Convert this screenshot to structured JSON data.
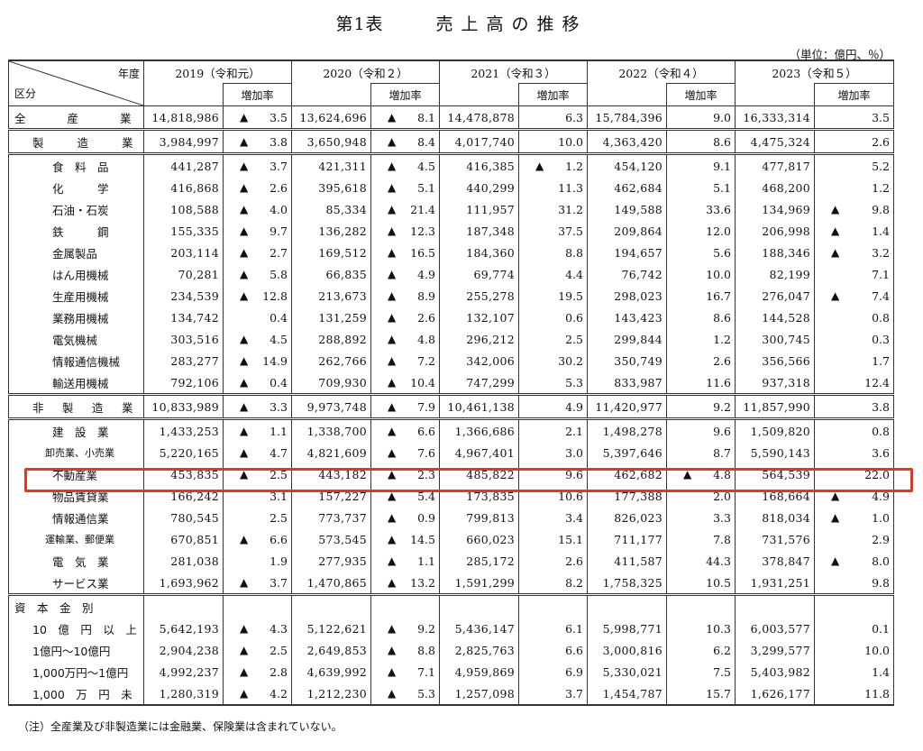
{
  "title": {
    "part1": "第1表",
    "part2": "売上高の推移"
  },
  "unit": "（単位：億円、％）",
  "header": {
    "nendo": "年度",
    "kubun": "区分",
    "years": [
      "2019（令和元）",
      "2020（令和２）",
      "2021（令和３）",
      "2022（令和４）",
      "2023（令和５）"
    ],
    "rate_label": "増加率"
  },
  "rows": [
    {
      "label": "全　　産　　業",
      "style": "grp",
      "vals": [
        [
          "14,818,986",
          "▲",
          "3.5"
        ],
        [
          "13,624,696",
          "▲",
          "8.1"
        ],
        [
          "14,478,878",
          "",
          "6.3"
        ],
        [
          "15,784,396",
          "",
          "9.0"
        ],
        [
          "16,333,314",
          "",
          "3.5"
        ]
      ]
    },
    {
      "label": "製　　造　　業",
      "style": "grp2",
      "vals": [
        [
          "3,984,997",
          "▲",
          "3.8"
        ],
        [
          "3,650,948",
          "▲",
          "8.4"
        ],
        [
          "4,017,740",
          "",
          "10.0"
        ],
        [
          "4,363,420",
          "",
          "8.6"
        ],
        [
          "4,475,324",
          "",
          "2.6"
        ]
      ]
    },
    {
      "label": "食　料　品",
      "style": "item",
      "vals": [
        [
          "441,287",
          "▲",
          "3.7"
        ],
        [
          "421,311",
          "▲",
          "4.5"
        ],
        [
          "416,385",
          "▲",
          "1.2"
        ],
        [
          "454,120",
          "",
          "9.1"
        ],
        [
          "477,817",
          "",
          "5.2"
        ]
      ]
    },
    {
      "label": "化　　　学",
      "style": "item",
      "vals": [
        [
          "416,868",
          "▲",
          "2.6"
        ],
        [
          "395,618",
          "▲",
          "5.1"
        ],
        [
          "440,299",
          "",
          "11.3"
        ],
        [
          "462,684",
          "",
          "5.1"
        ],
        [
          "468,200",
          "",
          "1.2"
        ]
      ]
    },
    {
      "label": "石油・石炭",
      "style": "item",
      "vals": [
        [
          "108,588",
          "▲",
          "4.0"
        ],
        [
          "85,334",
          "▲",
          "21.4"
        ],
        [
          "111,957",
          "",
          "31.2"
        ],
        [
          "149,588",
          "",
          "33.6"
        ],
        [
          "134,969",
          "▲",
          "9.8"
        ]
      ]
    },
    {
      "label": "鉄　　　鋼",
      "style": "item",
      "vals": [
        [
          "155,335",
          "▲",
          "9.7"
        ],
        [
          "136,282",
          "▲",
          "12.3"
        ],
        [
          "187,348",
          "",
          "37.5"
        ],
        [
          "209,864",
          "",
          "12.0"
        ],
        [
          "206,998",
          "▲",
          "1.4"
        ]
      ]
    },
    {
      "label": "金属製品",
      "style": "item",
      "vals": [
        [
          "203,114",
          "▲",
          "2.7"
        ],
        [
          "169,512",
          "▲",
          "16.5"
        ],
        [
          "184,360",
          "",
          "8.8"
        ],
        [
          "194,657",
          "",
          "5.6"
        ],
        [
          "188,346",
          "▲",
          "3.2"
        ]
      ]
    },
    {
      "label": "はん用機械",
      "style": "item",
      "vals": [
        [
          "70,281",
          "▲",
          "5.8"
        ],
        [
          "66,835",
          "▲",
          "4.9"
        ],
        [
          "69,774",
          "",
          "4.4"
        ],
        [
          "76,742",
          "",
          "10.0"
        ],
        [
          "82,199",
          "",
          "7.1"
        ]
      ]
    },
    {
      "label": "生産用機械",
      "style": "item",
      "vals": [
        [
          "234,539",
          "▲",
          "12.8"
        ],
        [
          "213,673",
          "▲",
          "8.9"
        ],
        [
          "255,278",
          "",
          "19.5"
        ],
        [
          "298,023",
          "",
          "16.7"
        ],
        [
          "276,047",
          "▲",
          "7.4"
        ]
      ]
    },
    {
      "label": "業務用機械",
      "style": "item",
      "vals": [
        [
          "134,742",
          "",
          "0.4"
        ],
        [
          "131,259",
          "▲",
          "2.6"
        ],
        [
          "132,107",
          "",
          "0.6"
        ],
        [
          "143,423",
          "",
          "8.6"
        ],
        [
          "144,528",
          "",
          "0.8"
        ]
      ]
    },
    {
      "label": "電気機械",
      "style": "item",
      "vals": [
        [
          "303,516",
          "▲",
          "4.5"
        ],
        [
          "288,892",
          "▲",
          "4.8"
        ],
        [
          "296,212",
          "",
          "2.5"
        ],
        [
          "299,844",
          "",
          "1.2"
        ],
        [
          "300,745",
          "",
          "0.3"
        ]
      ]
    },
    {
      "label": "情報通信機械",
      "style": "item",
      "vals": [
        [
          "283,277",
          "▲",
          "14.9"
        ],
        [
          "262,766",
          "▲",
          "7.2"
        ],
        [
          "342,006",
          "",
          "30.2"
        ],
        [
          "350,749",
          "",
          "2.6"
        ],
        [
          "356,566",
          "",
          "1.7"
        ]
      ]
    },
    {
      "label": "輸送用機械",
      "style": "item",
      "vals": [
        [
          "792,106",
          "▲",
          "0.4"
        ],
        [
          "709,930",
          "▲",
          "10.4"
        ],
        [
          "747,299",
          "",
          "5.3"
        ],
        [
          "833,987",
          "",
          "11.6"
        ],
        [
          "937,318",
          "",
          "12.4"
        ]
      ]
    },
    {
      "label": "非　製　造　業",
      "style": "grp2",
      "vals": [
        [
          "10,833,989",
          "▲",
          "3.3"
        ],
        [
          "9,973,748",
          "▲",
          "7.9"
        ],
        [
          "10,461,138",
          "",
          "4.9"
        ],
        [
          "11,420,977",
          "",
          "9.2"
        ],
        [
          "11,857,990",
          "",
          "3.8"
        ]
      ]
    },
    {
      "label": "建　設　業",
      "style": "item",
      "vals": [
        [
          "1,433,253",
          "▲",
          "1.1"
        ],
        [
          "1,338,700",
          "▲",
          "6.6"
        ],
        [
          "1,366,686",
          "",
          "2.1"
        ],
        [
          "1,498,278",
          "",
          "9.6"
        ],
        [
          "1,509,820",
          "",
          "0.8"
        ]
      ]
    },
    {
      "label": "卸売業、小売業",
      "style": "itemsm",
      "vals": [
        [
          "5,220,165",
          "▲",
          "4.7"
        ],
        [
          "4,821,609",
          "▲",
          "7.6"
        ],
        [
          "4,967,401",
          "",
          "3.0"
        ],
        [
          "5,397,646",
          "",
          "8.7"
        ],
        [
          "5,590,143",
          "",
          "3.6"
        ]
      ]
    },
    {
      "label": "不動産業",
      "style": "item",
      "vals": [
        [
          "453,835",
          "▲",
          "2.5"
        ],
        [
          "443,182",
          "▲",
          "2.3"
        ],
        [
          "485,822",
          "",
          "9.6"
        ],
        [
          "462,682",
          "▲",
          "4.8"
        ],
        [
          "564,539",
          "",
          "22.0"
        ]
      ]
    },
    {
      "label": "物品賃貸業",
      "style": "item",
      "vals": [
        [
          "166,242",
          "",
          "3.1"
        ],
        [
          "157,227",
          "▲",
          "5.4"
        ],
        [
          "173,835",
          "",
          "10.6"
        ],
        [
          "177,388",
          "",
          "2.0"
        ],
        [
          "168,664",
          "▲",
          "4.9"
        ]
      ]
    },
    {
      "label": "情報通信業",
      "style": "item",
      "vals": [
        [
          "780,545",
          "",
          "2.5"
        ],
        [
          "773,737",
          "▲",
          "0.9"
        ],
        [
          "799,813",
          "",
          "3.4"
        ],
        [
          "826,023",
          "",
          "3.3"
        ],
        [
          "818,034",
          "▲",
          "1.0"
        ]
      ]
    },
    {
      "label": "運輸業、郵便業",
      "style": "itemsm",
      "vals": [
        [
          "670,851",
          "▲",
          "6.6"
        ],
        [
          "573,545",
          "▲",
          "14.5"
        ],
        [
          "660,023",
          "",
          "15.1"
        ],
        [
          "711,177",
          "",
          "7.8"
        ],
        [
          "731,576",
          "",
          "2.9"
        ]
      ]
    },
    {
      "label": "電　気　業",
      "style": "item",
      "vals": [
        [
          "281,038",
          "",
          "1.9"
        ],
        [
          "277,935",
          "▲",
          "1.1"
        ],
        [
          "285,172",
          "",
          "2.6"
        ],
        [
          "411,587",
          "",
          "44.3"
        ],
        [
          "378,847",
          "▲",
          "8.0"
        ]
      ]
    },
    {
      "label": "サービス業",
      "style": "item",
      "vals": [
        [
          "1,693,962",
          "▲",
          "3.7"
        ],
        [
          "1,470,865",
          "▲",
          "13.2"
        ],
        [
          "1,591,299",
          "",
          "8.2"
        ],
        [
          "1,758,325",
          "",
          "10.5"
        ],
        [
          "1,931,251",
          "",
          "9.8"
        ]
      ]
    }
  ],
  "capital_header": "資　本　金　別",
  "capital_rows": [
    {
      "label": "10　億　円　以　上",
      "vals": [
        [
          "5,642,193",
          "▲",
          "4.3"
        ],
        [
          "5,122,621",
          "▲",
          "9.2"
        ],
        [
          "5,436,147",
          "",
          "6.1"
        ],
        [
          "5,998,771",
          "",
          "10.3"
        ],
        [
          "6,003,577",
          "",
          "0.1"
        ]
      ]
    },
    {
      "label": "1億円～10億円",
      "vals": [
        [
          "2,904,238",
          "▲",
          "2.5"
        ],
        [
          "2,649,853",
          "▲",
          "8.8"
        ],
        [
          "2,825,763",
          "",
          "6.6"
        ],
        [
          "3,000,816",
          "",
          "6.2"
        ],
        [
          "3,299,577",
          "",
          "10.0"
        ]
      ]
    },
    {
      "label": "1,000万円～1億円",
      "vals": [
        [
          "4,992,237",
          "▲",
          "2.8"
        ],
        [
          "4,639,992",
          "▲",
          "7.1"
        ],
        [
          "4,959,869",
          "",
          "6.9"
        ],
        [
          "5,330,021",
          "",
          "7.5"
        ],
        [
          "5,403,982",
          "",
          "1.4"
        ]
      ]
    },
    {
      "label": "1,000　万　円　未　満",
      "vals": [
        [
          "1,280,319",
          "▲",
          "4.2"
        ],
        [
          "1,212,230",
          "▲",
          "5.3"
        ],
        [
          "1,257,098",
          "",
          "3.7"
        ],
        [
          "1,454,787",
          "",
          "15.7"
        ],
        [
          "1,626,177",
          "",
          "11.8"
        ]
      ]
    }
  ],
  "note": "（注）全産業及び非製造業には金融業、保険業は含まれていない。"
}
